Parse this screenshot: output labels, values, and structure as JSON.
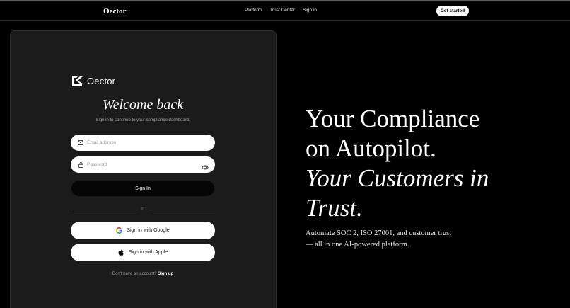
{
  "nav": {
    "brand": "Oector",
    "links": [
      "Platform",
      "Trust Center",
      "Sign in"
    ],
    "cta": "Get started"
  },
  "login": {
    "logo_text": "Oector",
    "title": "Welcome back",
    "subtitle": "Sign in to continue to your compliance dashboard.",
    "email_placeholder": "Email address",
    "password_placeholder": "Password",
    "signin_label": "Sign In",
    "divider_text": "or",
    "google_label": "Sign in with Google",
    "apple_label": "Sign in with Apple",
    "signup_prompt": "Don't have an account?",
    "signup_link": "Sign up"
  },
  "hero": {
    "line1": "Your Compliance",
    "line2": "on Autopilot.",
    "line3": "Your Customers in",
    "line4": "Trust.",
    "sub_line1": "Automate SOC 2, ISO 27001, and customer trust",
    "sub_line2": "— all in one AI-powered platform."
  },
  "colors": {
    "background": "#000000",
    "card": "#1b1b1b",
    "button_light": "#ffffff",
    "google_blue": "#4285F4",
    "google_red": "#EA4335",
    "google_yellow": "#FBBC05",
    "google_green": "#34A853"
  },
  "icons": {
    "email": "mail-icon",
    "password": "lock-icon",
    "reveal": "eye-icon",
    "google": "google-icon",
    "apple": "apple-icon"
  }
}
